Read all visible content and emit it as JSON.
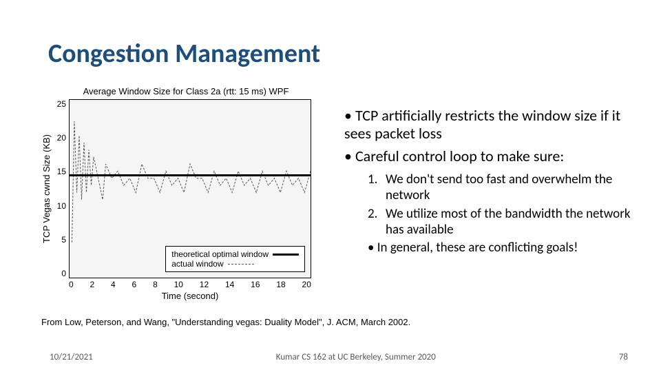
{
  "title": "Congestion Management",
  "chart_data": {
    "type": "line",
    "title": "Average Window Size for Class 2a (rtt: 15 ms) WPF",
    "xlabel": "Time (second)",
    "ylabel": "TCP Vegas cwnd Size (KB)",
    "xlim": [
      0,
      20
    ],
    "ylim": [
      0,
      25
    ],
    "xticks": [
      0,
      2,
      4,
      6,
      8,
      10,
      12,
      14,
      16,
      18,
      20
    ],
    "yticks": [
      0,
      5,
      10,
      15,
      20,
      25
    ],
    "series": [
      {
        "name": "theoretical optimal window",
        "style": "solid",
        "x": [
          0,
          20
        ],
        "y": [
          14.5,
          14.5
        ]
      },
      {
        "name": "actual window",
        "style": "dashed",
        "x": [
          0.2,
          0.4,
          0.6,
          0.8,
          1.0,
          1.2,
          1.4,
          1.6,
          1.8,
          2.0,
          2.5,
          3.0,
          4,
          5,
          6,
          7,
          8,
          9,
          10,
          11,
          12,
          13,
          14,
          15,
          16,
          17,
          18,
          19,
          20
        ],
        "y": [
          5,
          22,
          12,
          20,
          11,
          19,
          12,
          18,
          13,
          17,
          13,
          16,
          15,
          14,
          16,
          14,
          15,
          14,
          16,
          14,
          15,
          14,
          15,
          14,
          15,
          14,
          15,
          14,
          15
        ],
        "note": "oscillating sawtooth around ~14–16 after transient spike near t≈0.4"
      }
    ],
    "legend": {
      "position": "bottom-right",
      "items": [
        "theoretical optimal window",
        "actual window"
      ]
    }
  },
  "caption": "From Low, Peterson, and Wang, \"Understanding vegas: Duality Model\", J. ACM, March 2002.",
  "bullets": {
    "b1": "TCP artificially restricts the window size if it sees packet loss",
    "b2": "Careful control loop to make sure:",
    "s1": "We don't send too fast and overwhelm the network",
    "s2": "We utilize most of the bandwidth the network has available",
    "s3": "In general, these are conflicting goals!"
  },
  "footer": {
    "date": "10/21/2021",
    "center": "Kumar CS 162 at UC Berkeley, Summer 2020",
    "page": "78"
  }
}
